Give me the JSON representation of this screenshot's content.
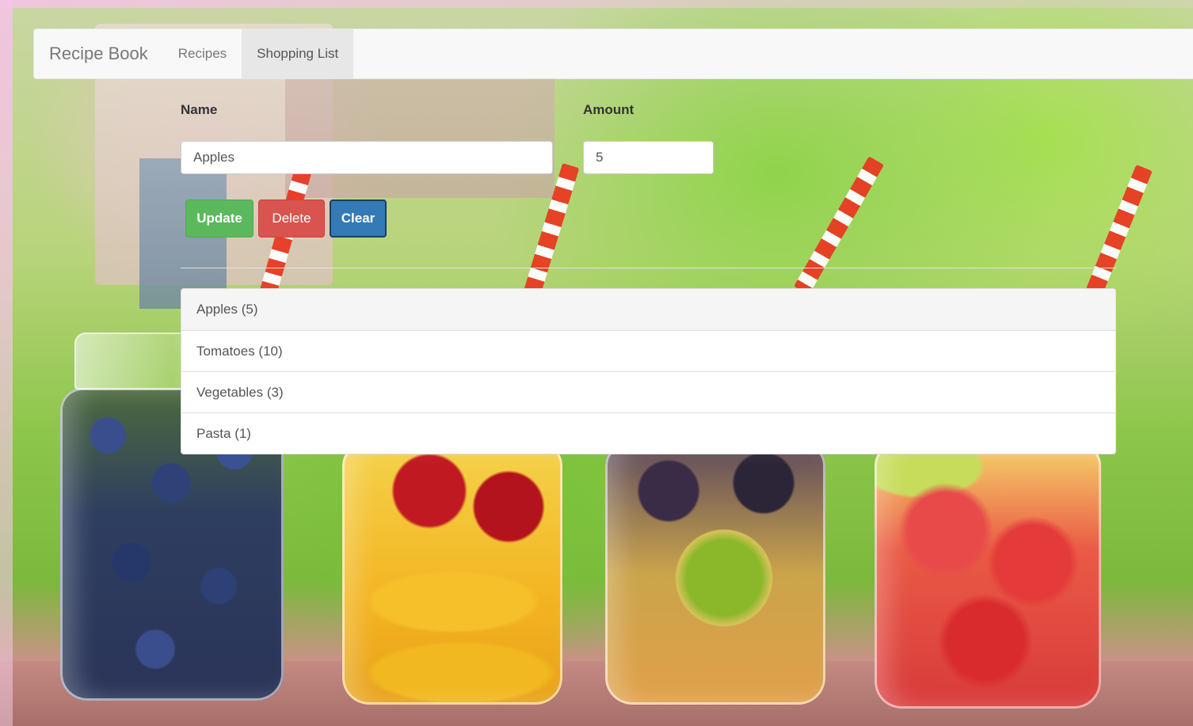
{
  "navbar": {
    "brand": "Recipe Book",
    "links": [
      {
        "label": "Recipes",
        "active": false
      },
      {
        "label": "Shopping List",
        "active": true
      }
    ]
  },
  "form": {
    "name_label": "Name",
    "amount_label": "Amount",
    "name_value": "Apples",
    "amount_value": "5"
  },
  "buttons": {
    "update": "Update",
    "delete": "Delete",
    "clear": "Clear"
  },
  "shopping_list": [
    {
      "text": "Apples (5)",
      "selected": true
    },
    {
      "text": "Tomatoes (10)",
      "selected": false
    },
    {
      "text": "Vegetables (3)",
      "selected": false
    },
    {
      "text": "Pasta (1)",
      "selected": false
    }
  ],
  "colors": {
    "update_button": "#5cb85c",
    "delete_button": "#d9534f",
    "clear_button": "#337ab7",
    "navbar_bg": "#f8f8f8",
    "active_nav_bg": "#e7e7e7"
  }
}
